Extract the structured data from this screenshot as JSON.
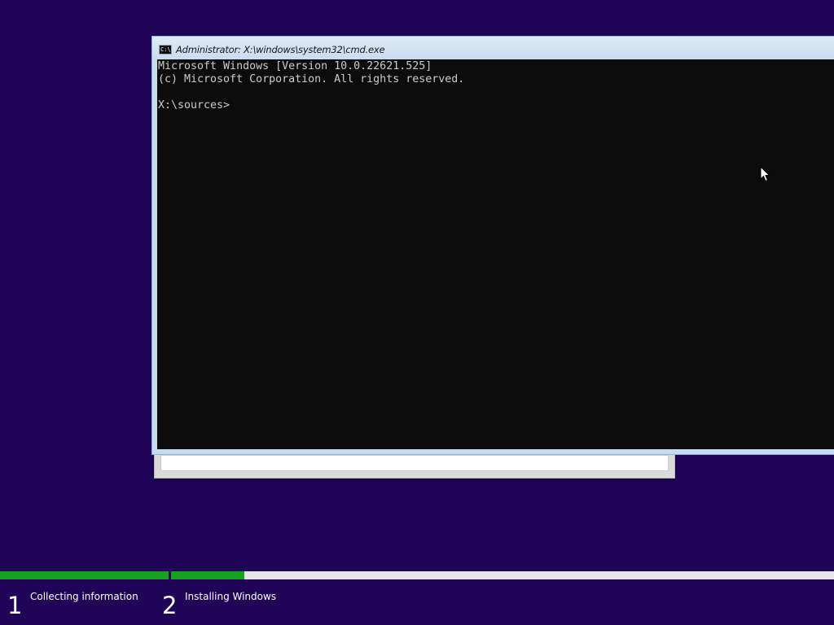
{
  "colors": {
    "desktop_background": "#1f0457",
    "progress_fill": "#15a31f",
    "progress_track": "#e6e6e6",
    "console_background": "#0c0c0c",
    "console_text": "#cccccc"
  },
  "cmd_window": {
    "icon_text": "C:\\",
    "title": "Administrator: X:\\windows\\system32\\cmd.exe",
    "console_lines": [
      "Microsoft Windows [Version 10.0.22621.525]",
      "(c) Microsoft Corporation. All rights reserved.",
      "",
      "X:\\sources>"
    ]
  },
  "setup": {
    "steps": [
      {
        "number": "1",
        "label": "Collecting information",
        "progress": 1.0
      },
      {
        "number": "2",
        "label": "Installing Windows",
        "progress": 0.11
      }
    ]
  },
  "icons": {
    "cmd_icon": "command-prompt-icon",
    "cursor": "mouse-pointer-icon"
  }
}
